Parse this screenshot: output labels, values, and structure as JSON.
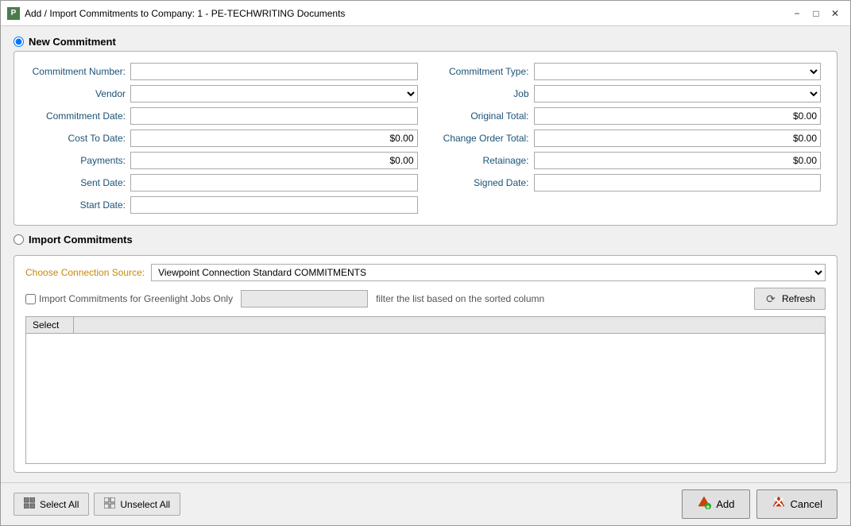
{
  "window": {
    "title": "Add / Import Commitments to Company: 1 - PE-TECHWRITING Documents",
    "icon": "P"
  },
  "sections": {
    "new_commitment": {
      "label": "New Commitment",
      "radio_name": "mode",
      "radio_value": "new",
      "selected": true,
      "fields": {
        "left": [
          {
            "label": "Commitment Number:",
            "type": "text",
            "value": "",
            "name": "commitment-number"
          },
          {
            "label": "Vendor",
            "type": "select",
            "value": "",
            "name": "vendor"
          },
          {
            "label": "Commitment Date:",
            "type": "text",
            "value": "",
            "name": "commitment-date"
          },
          {
            "label": "Cost To Date:",
            "type": "text",
            "value": "$0.00",
            "name": "cost-to-date",
            "money": true
          },
          {
            "label": "Payments:",
            "type": "text",
            "value": "$0.00",
            "name": "payments",
            "money": true
          },
          {
            "label": "Sent Date:",
            "type": "text",
            "value": "",
            "name": "sent-date"
          },
          {
            "label": "Start Date:",
            "type": "text",
            "value": "",
            "name": "start-date"
          }
        ],
        "right": [
          {
            "label": "Commitment Type:",
            "type": "select",
            "value": "",
            "name": "commitment-type"
          },
          {
            "label": "Job",
            "type": "select",
            "value": "",
            "name": "job"
          },
          {
            "label": "Original Total:",
            "type": "text",
            "value": "$0.00",
            "name": "original-total",
            "money": true
          },
          {
            "label": "Change Order Total:",
            "type": "text",
            "value": "$0.00",
            "name": "change-order-total",
            "money": true
          },
          {
            "label": "Retainage:",
            "type": "text",
            "value": "$0.00",
            "name": "retainage",
            "money": true
          },
          {
            "label": "Signed Date:",
            "type": "text",
            "value": "",
            "name": "signed-date"
          }
        ]
      }
    },
    "import_commitments": {
      "label": "Import Commitments",
      "radio_name": "mode",
      "radio_value": "import",
      "selected": false,
      "connection_label": "Choose Connection Source:",
      "connection_value": "Viewpoint Connection Standard COMMITMENTS",
      "filter_checkbox_label": "Import Commitments for Greenlight Jobs Only",
      "filter_placeholder": "",
      "filter_hint": "filter the list based on the sorted column",
      "refresh_label": "Refresh",
      "list_header": "Select"
    }
  },
  "bottom": {
    "select_all_label": "Select All",
    "unselect_all_label": "Unselect All",
    "add_label": "Add",
    "cancel_label": "Cancel"
  }
}
